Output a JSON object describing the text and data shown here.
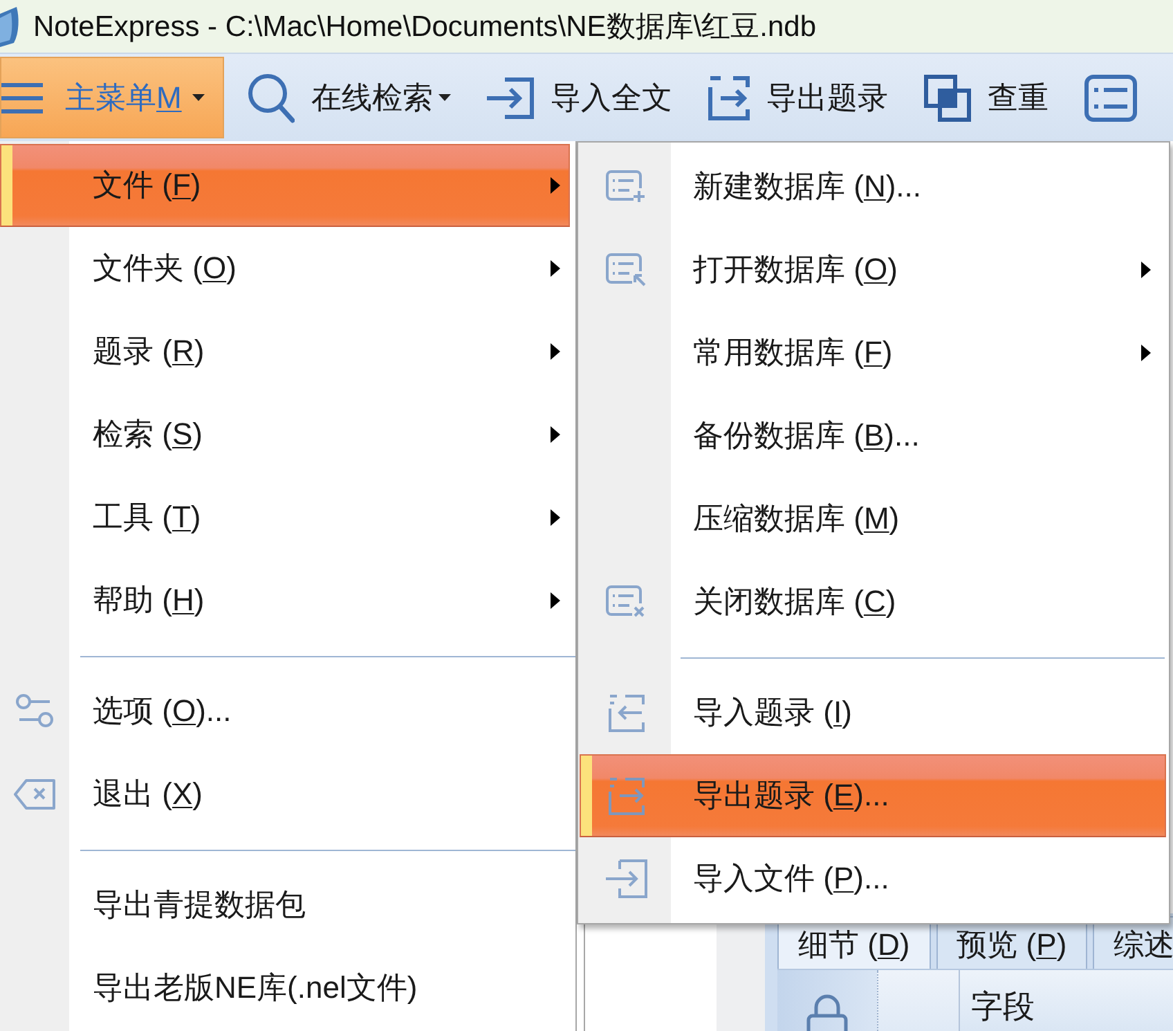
{
  "window": {
    "title": "NoteExpress - C:\\Mac\\Home\\Documents\\NE数据库\\红豆.ndb"
  },
  "toolbar": [
    {
      "kind": "menu",
      "text": "主菜单",
      "hotkey": "M",
      "dropdown": true,
      "selected": true
    },
    {
      "kind": "search",
      "text": "在线检索",
      "dropdown": true,
      "selected": false
    },
    {
      "kind": "import",
      "text": "导入全文",
      "dropdown": false,
      "selected": false
    },
    {
      "kind": "export",
      "text": "导出题录",
      "dropdown": false,
      "selected": false
    },
    {
      "kind": "duplicates",
      "text": "查重",
      "dropdown": false,
      "selected": false
    },
    {
      "kind": "list",
      "dropdown": false,
      "selected": false
    }
  ],
  "main_menu": {
    "items": [
      {
        "kind": "plain",
        "text": "文件 (",
        "hotkey": "F",
        "text_after": ")",
        "submenu": true,
        "selected": true
      },
      {
        "kind": "plain",
        "text": "文件夹 (",
        "hotkey": "O",
        "text_after": ")",
        "submenu": true,
        "selected": false
      },
      {
        "kind": "plain",
        "text": "题录 (",
        "hotkey": "R",
        "text_after": ")",
        "submenu": true,
        "selected": false
      },
      {
        "kind": "plain",
        "text": "检索 (",
        "hotkey": "S",
        "text_after": ")",
        "submenu": true,
        "selected": false
      },
      {
        "kind": "plain",
        "text": "工具 (",
        "hotkey": "T",
        "text_after": ")",
        "submenu": true,
        "selected": false
      },
      {
        "kind": "plain",
        "text": "帮助 (",
        "hotkey": "H",
        "text_after": ")",
        "submenu": true,
        "selected": false
      },
      {
        "kind": "separator"
      },
      {
        "kind": "options",
        "text": "选项 (",
        "hotkey": "O",
        "text_after": ")...",
        "submenu": false,
        "selected": false
      },
      {
        "kind": "exit",
        "text": "退出 (",
        "hotkey": "X",
        "text_after": ")",
        "submenu": false,
        "selected": false
      },
      {
        "kind": "separator"
      },
      {
        "kind": "plain",
        "text": "导出青提数据包",
        "submenu": false,
        "selected": false
      },
      {
        "kind": "plain",
        "text": "导出老版NE库(.nel文件)",
        "submenu": false,
        "selected": false
      }
    ]
  },
  "submenu": {
    "items": [
      {
        "kind": "new",
        "text": "新建数据库 (",
        "hotkey": "N",
        "text_after": ")...",
        "submenu": false,
        "selected": false
      },
      {
        "kind": "open",
        "text": "打开数据库 (",
        "hotkey": "O",
        "text_after": ")",
        "submenu": true,
        "selected": false
      },
      {
        "kind": "plain",
        "text": "常用数据库 (",
        "hotkey": "F",
        "text_after": ")",
        "submenu": true,
        "selected": false
      },
      {
        "kind": "plain",
        "text": "备份数据库 (",
        "hotkey": "B",
        "text_after": ")...",
        "submenu": false,
        "selected": false
      },
      {
        "kind": "plain",
        "text": "压缩数据库 (",
        "hotkey": "M",
        "text_after": ")",
        "submenu": false,
        "selected": false
      },
      {
        "kind": "close",
        "text": "关闭数据库 (",
        "hotkey": "C",
        "text_after": ")",
        "submenu": false,
        "selected": false
      },
      {
        "kind": "separator"
      },
      {
        "kind": "import",
        "text": "导入题录 (",
        "hotkey": "I",
        "text_after": ")",
        "submenu": false,
        "selected": false
      },
      {
        "kind": "export",
        "text": "导出题录 (",
        "hotkey": "E",
        "text_after": ")...",
        "submenu": false,
        "selected": true
      },
      {
        "kind": "file",
        "text": "导入文件 (",
        "hotkey": "P",
        "text_after": ")...",
        "submenu": false,
        "selected": false
      }
    ]
  },
  "detail_pane": {
    "tabs": [
      {
        "text": "细节 (",
        "hotkey": "D",
        "text_after": ")",
        "selected": true
      },
      {
        "text": "预览 (",
        "hotkey": "P",
        "text_after": ")",
        "selected": false
      },
      {
        "text": "综述",
        "selected": false
      }
    ],
    "header": [
      {
        "kind": "lock"
      },
      {
        "kind": "text",
        "text": "字段"
      }
    ]
  }
}
